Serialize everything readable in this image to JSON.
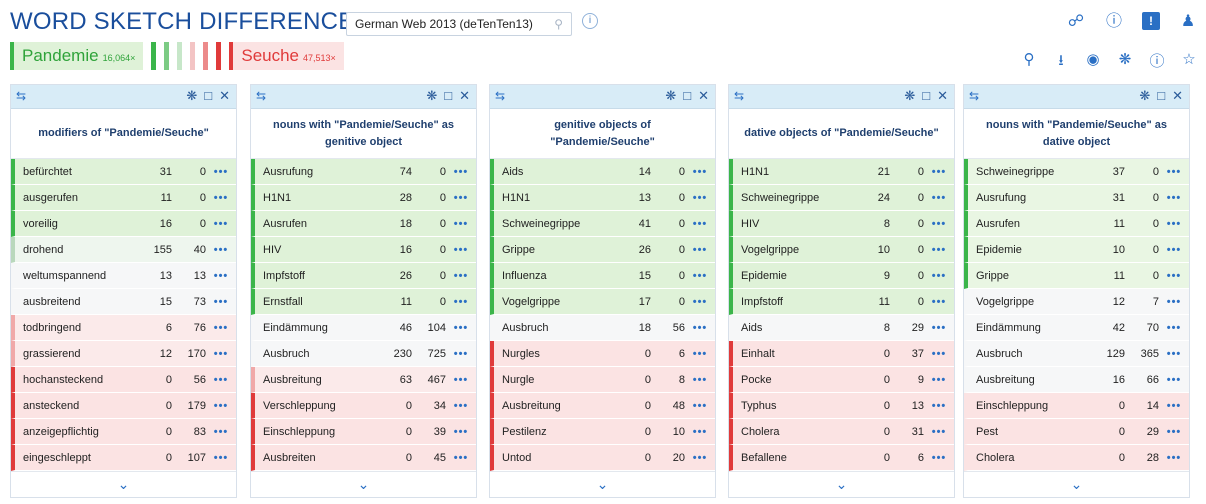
{
  "header": {
    "title": "WORD SKETCH DIFFERENCE",
    "corpus": "German Web 2013 (deTenTen13)"
  },
  "legend": {
    "word_a": "Pandemie",
    "freq_a": "16,064×",
    "word_b": "Seuche",
    "freq_b": "47,513×",
    "color_a": "#3bb54a",
    "color_b": "#e03a3a"
  },
  "top_icons": [
    "link-icon",
    "help-icon",
    "feedback-icon",
    "user-icon"
  ],
  "tool_icons": [
    "zoom-icon",
    "download-icon",
    "view-icon",
    "settings-icon",
    "info-icon",
    "star-icon"
  ],
  "more_label": "•••",
  "panels": [
    {
      "title": "modifiers of \"Pandemie/Seuche\"",
      "rows": [
        {
          "word": "befürchtet",
          "a": "31",
          "b": "0",
          "tone": "g3"
        },
        {
          "word": "ausgerufen",
          "a": "11",
          "b": "0",
          "tone": "g3"
        },
        {
          "word": "voreilig",
          "a": "16",
          "b": "0",
          "tone": "g3"
        },
        {
          "word": "drohend",
          "a": "155",
          "b": "40",
          "tone": "g1"
        },
        {
          "word": "weltumspannend",
          "a": "13",
          "b": "13",
          "tone": "n"
        },
        {
          "word": "ausbreitend",
          "a": "15",
          "b": "73",
          "tone": "n"
        },
        {
          "word": "todbringend",
          "a": "6",
          "b": "76",
          "tone": "r1"
        },
        {
          "word": "grassierend",
          "a": "12",
          "b": "170",
          "tone": "r1"
        },
        {
          "word": "hochansteckend",
          "a": "0",
          "b": "56",
          "tone": "r3"
        },
        {
          "word": "ansteckend",
          "a": "0",
          "b": "179",
          "tone": "r3"
        },
        {
          "word": "anzeigepflichtig",
          "a": "0",
          "b": "83",
          "tone": "r3"
        },
        {
          "word": "eingeschleppt",
          "a": "0",
          "b": "107",
          "tone": "r3"
        }
      ]
    },
    {
      "title": "nouns with \"Pandemie/Seuche\" as genitive object",
      "rows": [
        {
          "word": "Ausrufung",
          "a": "74",
          "b": "0",
          "tone": "g3"
        },
        {
          "word": "H1N1",
          "a": "28",
          "b": "0",
          "tone": "g3"
        },
        {
          "word": "Ausrufen",
          "a": "18",
          "b": "0",
          "tone": "g3"
        },
        {
          "word": "HIV",
          "a": "16",
          "b": "0",
          "tone": "g3"
        },
        {
          "word": "Impfstoff",
          "a": "26",
          "b": "0",
          "tone": "g3"
        },
        {
          "word": "Ernstfall",
          "a": "11",
          "b": "0",
          "tone": "g3"
        },
        {
          "word": "Eindämmung",
          "a": "46",
          "b": "104",
          "tone": "n"
        },
        {
          "word": "Ausbruch",
          "a": "230",
          "b": "725",
          "tone": "n"
        },
        {
          "word": "Ausbreitung",
          "a": "63",
          "b": "467",
          "tone": "r1"
        },
        {
          "word": "Verschleppung",
          "a": "0",
          "b": "34",
          "tone": "r3"
        },
        {
          "word": "Einschleppung",
          "a": "0",
          "b": "39",
          "tone": "r3"
        },
        {
          "word": "Ausbreiten",
          "a": "0",
          "b": "45",
          "tone": "r3"
        }
      ]
    },
    {
      "title": "genitive objects of \"Pandemie/Seuche\"",
      "rows": [
        {
          "word": "Aids",
          "a": "14",
          "b": "0",
          "tone": "g3"
        },
        {
          "word": "H1N1",
          "a": "13",
          "b": "0",
          "tone": "g3"
        },
        {
          "word": "Schweinegrippe",
          "a": "41",
          "b": "0",
          "tone": "g3"
        },
        {
          "word": "Grippe",
          "a": "26",
          "b": "0",
          "tone": "g3"
        },
        {
          "word": "Influenza",
          "a": "15",
          "b": "0",
          "tone": "g3"
        },
        {
          "word": "Vogelgrippe",
          "a": "17",
          "b": "0",
          "tone": "g3"
        },
        {
          "word": "Ausbruch",
          "a": "18",
          "b": "56",
          "tone": "n"
        },
        {
          "word": "Nurgles",
          "a": "0",
          "b": "6",
          "tone": "r3"
        },
        {
          "word": "Nurgle",
          "a": "0",
          "b": "8",
          "tone": "r3"
        },
        {
          "word": "Ausbreitung",
          "a": "0",
          "b": "48",
          "tone": "r3"
        },
        {
          "word": "Pestilenz",
          "a": "0",
          "b": "10",
          "tone": "r3"
        },
        {
          "word": "Untod",
          "a": "0",
          "b": "20",
          "tone": "r3"
        }
      ]
    },
    {
      "title": "dative objects of \"Pandemie/Seuche\"",
      "rows": [
        {
          "word": "H1N1",
          "a": "21",
          "b": "0",
          "tone": "g3"
        },
        {
          "word": "Schweinegrippe",
          "a": "24",
          "b": "0",
          "tone": "g3"
        },
        {
          "word": "HIV",
          "a": "8",
          "b": "0",
          "tone": "g3"
        },
        {
          "word": "Vogelgrippe",
          "a": "10",
          "b": "0",
          "tone": "g3"
        },
        {
          "word": "Epidemie",
          "a": "9",
          "b": "0",
          "tone": "g3"
        },
        {
          "word": "Impfstoff",
          "a": "11",
          "b": "0",
          "tone": "g3"
        },
        {
          "word": "Aids",
          "a": "8",
          "b": "29",
          "tone": "n"
        },
        {
          "word": "Einhalt",
          "a": "0",
          "b": "37",
          "tone": "r3"
        },
        {
          "word": "Pocke",
          "a": "0",
          "b": "9",
          "tone": "r3"
        },
        {
          "word": "Typhus",
          "a": "0",
          "b": "13",
          "tone": "r3"
        },
        {
          "word": "Cholera",
          "a": "0",
          "b": "31",
          "tone": "r3"
        },
        {
          "word": "Befallene",
          "a": "0",
          "b": "6",
          "tone": "r3"
        }
      ]
    },
    {
      "title": "nouns with \"Pandemie/Seuche\" as dative object",
      "rows": [
        {
          "word": "Schweinegrippe",
          "a": "37",
          "b": "0",
          "tone": "g2"
        },
        {
          "word": "Ausrufung",
          "a": "31",
          "b": "0",
          "tone": "g2"
        },
        {
          "word": "Ausrufen",
          "a": "11",
          "b": "0",
          "tone": "g2"
        },
        {
          "word": "Epidemie",
          "a": "10",
          "b": "0",
          "tone": "g2"
        },
        {
          "word": "Grippe",
          "a": "11",
          "b": "0",
          "tone": "g2"
        },
        {
          "word": "Vogelgrippe",
          "a": "12",
          "b": "7",
          "tone": "n"
        },
        {
          "word": "Eindämmung",
          "a": "42",
          "b": "70",
          "tone": "n"
        },
        {
          "word": "Ausbruch",
          "a": "129",
          "b": "365",
          "tone": "n"
        },
        {
          "word": "Ausbreitung",
          "a": "16",
          "b": "66",
          "tone": "n"
        },
        {
          "word": "Einschleppung",
          "a": "0",
          "b": "14",
          "tone": "r2"
        },
        {
          "word": "Pest",
          "a": "0",
          "b": "29",
          "tone": "r2"
        },
        {
          "word": "Cholera",
          "a": "0",
          "b": "28",
          "tone": "r2"
        }
      ]
    }
  ]
}
